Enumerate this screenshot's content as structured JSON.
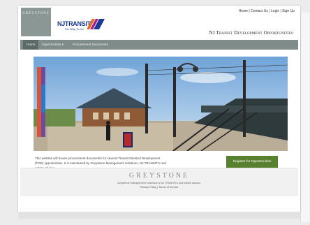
{
  "header": {
    "greystone_logo_text": "GREYSTONE",
    "nj_logo_text": "NJTRANSIT",
    "nj_logo_tagline": "The Way To Go.",
    "top_links": "Home | Contact Us | Login | Sign Up",
    "site_title": "NJ Transit Development Opportunities"
  },
  "nav": {
    "home": "Home",
    "opportunities": "Opportunities",
    "procurement": "Procurement Documents"
  },
  "main": {
    "hero_alt": "train-station-photo",
    "intro": "This website will house procurement documents for several Transit-Oriented Development (TOD) opportunities. It is maintained by Greystone Management Solutions, NJ TRANSIT's real estate advisor.",
    "register_label": "Register for Opportunities"
  },
  "footer": {
    "brand": "GREYSTONE",
    "line": "Greystone Management Solutions is NJ TRANSIT's real estate advisor.",
    "links": "Privacy Policy | Terms of Service"
  },
  "colors": {
    "nav_bg": "#7f8c89",
    "nav_active": "#5c6a67",
    "brand_grey": "#8a9794",
    "nj_blue": "#1b3a93",
    "register_green": "#58812f"
  }
}
